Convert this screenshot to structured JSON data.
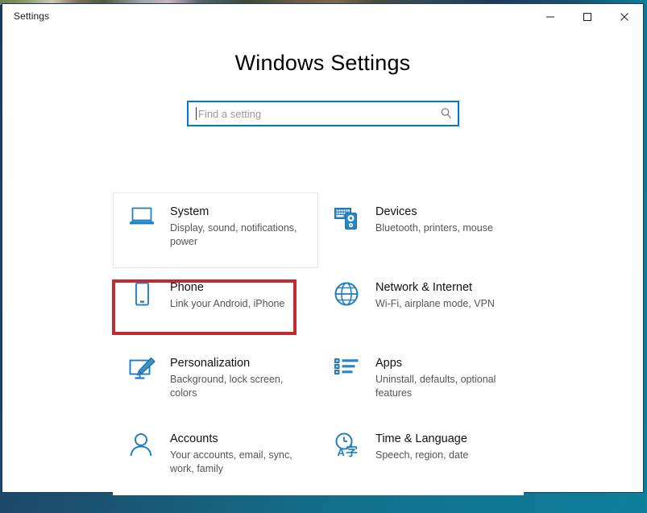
{
  "window": {
    "titlebar_title": "Settings",
    "controls": [
      {
        "name": "minimize",
        "glyph": "minimize-icon",
        "label": "Minimize"
      },
      {
        "name": "maximize",
        "glyph": "maximize-icon",
        "label": "Maximize"
      },
      {
        "name": "close",
        "glyph": "close-icon",
        "label": "Close"
      }
    ]
  },
  "page": {
    "heading": "Windows Settings"
  },
  "search": {
    "value": "",
    "placeholder": "Find a setting",
    "icon": "search-icon",
    "focused": true
  },
  "tiles": [
    {
      "id": "system",
      "icon": "laptop-icon",
      "title": "System",
      "desc": "Display, sound, notifications, power",
      "hovered": true
    },
    {
      "id": "devices",
      "icon": "keyboard-mouse-icon",
      "title": "Devices",
      "desc": "Bluetooth, printers, mouse",
      "hovered": false
    },
    {
      "id": "phone",
      "icon": "phone-icon",
      "title": "Phone",
      "desc": "Link your Android, iPhone",
      "hovered": false,
      "highlighted": true
    },
    {
      "id": "network-internet",
      "icon": "globe-icon",
      "title": "Network & Internet",
      "desc": "Wi-Fi, airplane mode, VPN",
      "hovered": false
    },
    {
      "id": "personalization",
      "icon": "monitor-brush-icon",
      "title": "Personalization",
      "desc": "Background, lock screen, colors",
      "hovered": false
    },
    {
      "id": "apps",
      "icon": "app-list-icon",
      "title": "Apps",
      "desc": "Uninstall, defaults, optional features",
      "hovered": false
    },
    {
      "id": "accounts",
      "icon": "person-icon",
      "title": "Accounts",
      "desc": "Your accounts, email, sync, work, family",
      "hovered": false
    },
    {
      "id": "time-language",
      "icon": "clock-language-icon",
      "title": "Time & Language",
      "desc": "Speech, region, date",
      "hovered": false
    }
  ],
  "annotation": {
    "target": "phone",
    "color": "#c32a2f",
    "shape": "rectangle"
  },
  "colors": {
    "accent": "#0078d7",
    "icon_blue": "#1f7ec4",
    "window_border": "#1d3557",
    "title_text": "#000000",
    "desc_text": "#555555",
    "annotation_red": "#c32a2f"
  }
}
